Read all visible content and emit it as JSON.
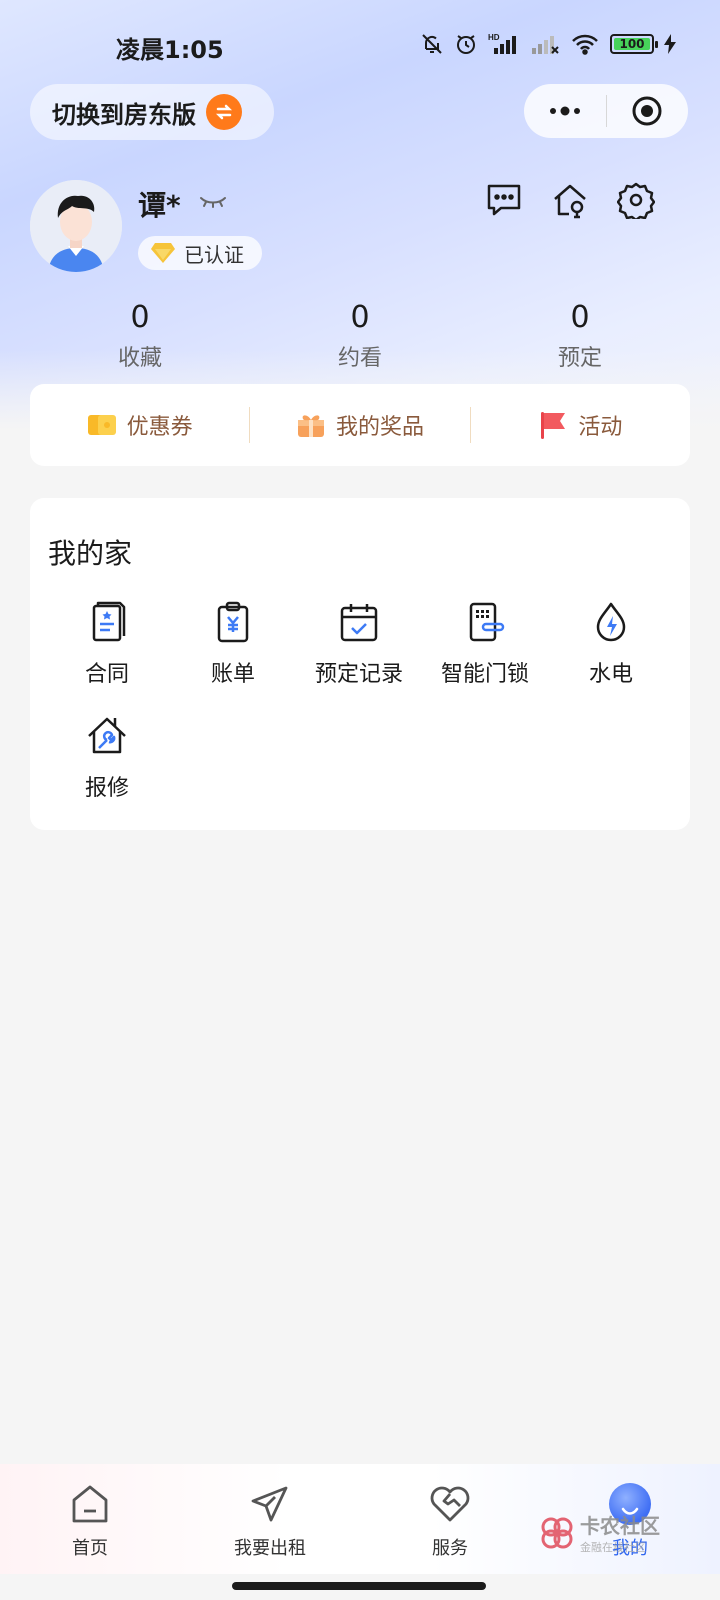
{
  "status_bar": {
    "time": "凌晨1:05",
    "battery": "100"
  },
  "switch": {
    "label": "切换到房东版"
  },
  "profile": {
    "name": "谭*",
    "verified_label": "已认证"
  },
  "stats": [
    {
      "value": "0",
      "label": "收藏"
    },
    {
      "value": "0",
      "label": "约看"
    },
    {
      "value": "0",
      "label": "预定"
    }
  ],
  "quick_links": [
    {
      "label": "优惠券",
      "icon": "coupon-icon"
    },
    {
      "label": "我的奖品",
      "icon": "gift-icon"
    },
    {
      "label": "活动",
      "icon": "flag-icon"
    }
  ],
  "home": {
    "title": "我的家",
    "items": [
      {
        "label": "合同",
        "icon": "contract-icon"
      },
      {
        "label": "账单",
        "icon": "bill-icon"
      },
      {
        "label": "预定记录",
        "icon": "calendar-icon"
      },
      {
        "label": "智能门锁",
        "icon": "smart-lock-icon"
      },
      {
        "label": "水电",
        "icon": "utility-icon"
      },
      {
        "label": "报修",
        "icon": "repair-icon"
      }
    ]
  },
  "nav": [
    {
      "label": "首页",
      "icon": "home-icon"
    },
    {
      "label": "我要出租",
      "icon": "paper-plane-icon"
    },
    {
      "label": "服务",
      "icon": "heart-hand-icon"
    },
    {
      "label": "我的",
      "icon": "profile-icon",
      "active": true
    }
  ],
  "watermark": {
    "text": "卡农社区",
    "sub": "金融在线社区"
  },
  "colors": {
    "accent": "#2f66f0",
    "badge": "#ff7a1a",
    "quick_text": "#8a5a3c"
  }
}
